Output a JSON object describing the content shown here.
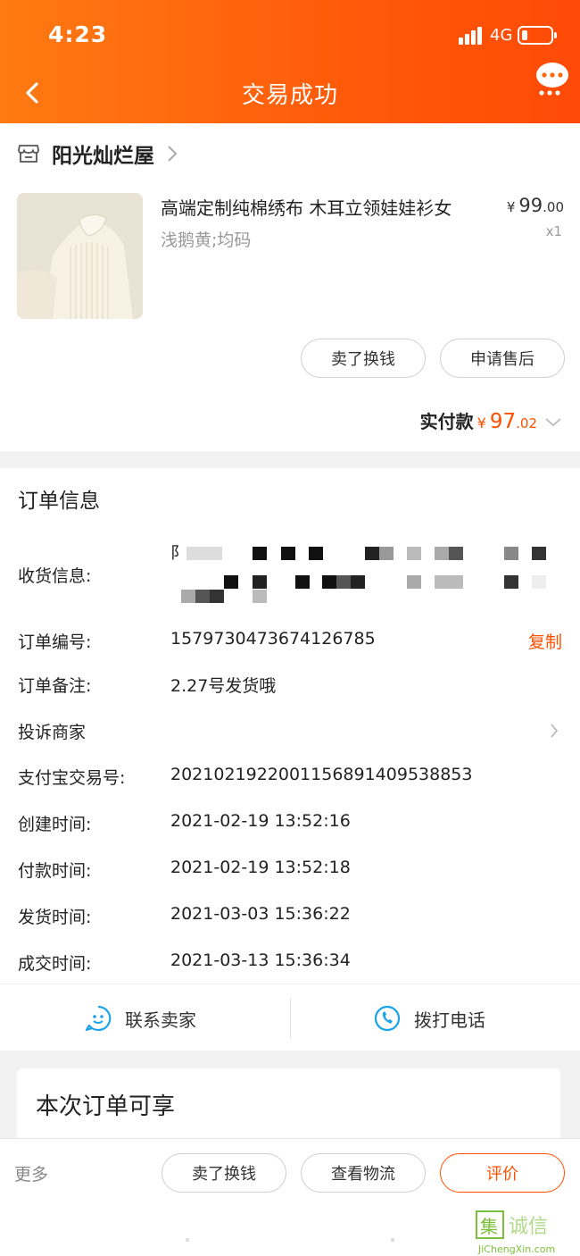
{
  "status_bar": {
    "time": "4:23",
    "network": "4G"
  },
  "nav": {
    "title": "交易成功",
    "back_icon": "back-arrow-icon",
    "more_icon": "chat-more-icon"
  },
  "shop": {
    "name": "阳光灿烂屋"
  },
  "product": {
    "title": "高端定制纯棉绣布 木耳立领娃娃衫女",
    "sku": "浅鹅黄;均码",
    "price_yen": "¥",
    "price_int": "99",
    "price_dec": ".00",
    "quantity": "x1"
  },
  "actions": {
    "sell": "卖了换钱",
    "after_sale": "申请售后"
  },
  "payment": {
    "label": "实付款",
    "yen": "¥",
    "int": "97",
    "dec": ".02"
  },
  "order_info": {
    "title": "订单信息",
    "address_label": "收货信息:",
    "address_prefix": "阝",
    "order_no_label": "订单编号:",
    "order_no": "1579730473674126785",
    "copy_label": "复制",
    "remark_label": "订单备注:",
    "remark": "2.27号发货哦",
    "complain_label": "投诉商家",
    "alipay_label": "支付宝交易号:",
    "alipay_no": "2021021922001156891409538853",
    "created_label": "创建时间:",
    "created": "2021-02-19 13:52:16",
    "paid_label": "付款时间:",
    "paid": "2021-02-19 13:52:18",
    "shipped_label": "发货时间:",
    "shipped": "2021-03-03 15:36:22",
    "completed_label": "成交时间:",
    "completed": "2021-03-13 15:36:34"
  },
  "contact": {
    "seller": "联系卖家",
    "call": "拨打电话"
  },
  "benefit": {
    "title": "本次订单可享"
  },
  "bottom": {
    "more": "更多",
    "sell": "卖了换钱",
    "logistics": "查看物流",
    "review": "评价"
  },
  "colors": {
    "accent": "#ff5000",
    "header_start": "#ff7a12",
    "header_end": "#ff4a07",
    "contact_icon": "#1aa3e8"
  }
}
